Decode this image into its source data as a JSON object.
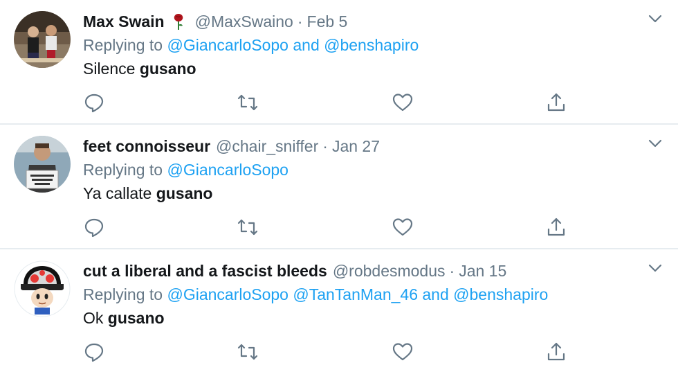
{
  "tweets": [
    {
      "display_name": "Max Swain",
      "has_rose": true,
      "handle": "@MaxSwaino",
      "separator": "·",
      "date": "Feb 5",
      "replying_prefix": "Replying to",
      "mentions": [
        "@GiancarloSopo",
        "@benshapiro"
      ],
      "mention_joiner": "and",
      "text_plain": "Silence",
      "text_bold": "gusano",
      "avatar_icon": "photo-avatar-two-people"
    },
    {
      "display_name": "feet connoisseur",
      "has_rose": false,
      "handle": "@chair_sniffer",
      "separator": "·",
      "date": "Jan 27",
      "replying_prefix": "Replying to",
      "mentions": [
        "@GiancarloSopo"
      ],
      "mention_joiner": "",
      "text_plain": "Ya callate",
      "text_bold": "gusano",
      "avatar_icon": "photo-avatar-person-with-sign"
    },
    {
      "display_name": "cut a liberal and a fascist bleeds",
      "has_rose": false,
      "handle": "@robdesmodus",
      "separator": "·",
      "date": "Jan 15",
      "replying_prefix": "Replying to",
      "mentions": [
        "@GiancarloSopo",
        "@TanTanMan_46",
        "@benshapiro"
      ],
      "mention_joiner": "and",
      "text_plain": "Ok",
      "text_bold": "gusano",
      "avatar_icon": "toad-character-avatar"
    }
  ],
  "colors": {
    "text": "#14171a",
    "muted": "#657786",
    "link": "#1da1f2",
    "divider": "#e6ecf0",
    "rose": "#b0141c"
  },
  "icons": {
    "reply": "reply-icon",
    "retweet": "retweet-icon",
    "like": "heart-icon",
    "share": "share-icon",
    "more": "chevron-down-icon"
  }
}
